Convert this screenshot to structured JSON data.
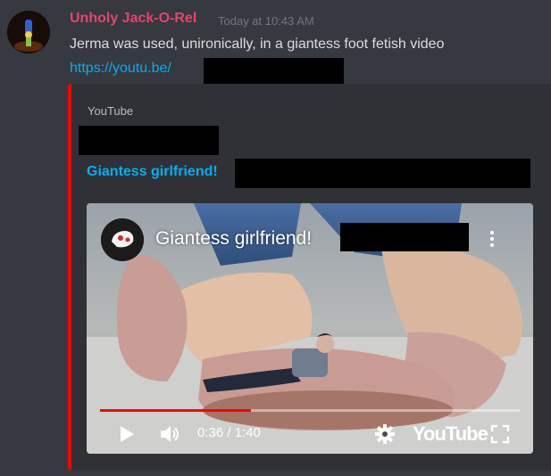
{
  "message": {
    "username": "Unholy Jack-O-Rel",
    "timestamp": "Today at 10:43 AM",
    "text": "Jerma was used, unironically, in a giantess foot fetish video",
    "link_text": "https://youtu.be/"
  },
  "embed": {
    "provider": "YouTube",
    "title": "Giantess girlfriend!",
    "accent_color": "#ff0000"
  },
  "video": {
    "title": "Giantess girlfriend!",
    "time": "0:36 / 1:40",
    "progress": 0.36,
    "logo_text": "YouTube"
  },
  "colors": {
    "username": "#e8426b",
    "link": "#00b0f4",
    "background": "#36393f",
    "embed_background": "#2f3136"
  },
  "icons": [
    "user-avatar",
    "channel-avatar",
    "more-options-icon",
    "play-icon",
    "volume-icon",
    "settings-gear-icon",
    "fullscreen-icon"
  ]
}
